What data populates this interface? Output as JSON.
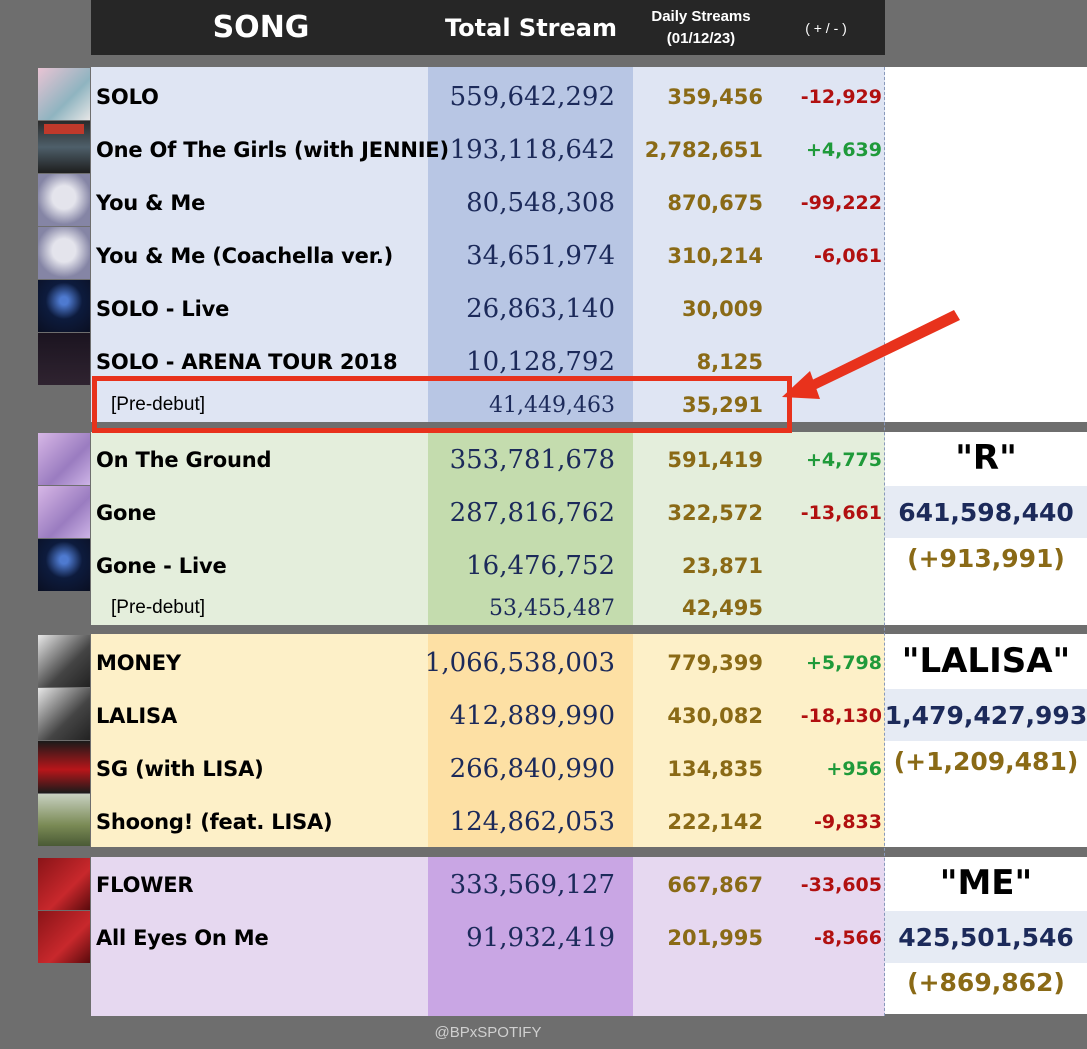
{
  "header": {
    "song": "SONG",
    "total_stream": "Total Stream",
    "daily_line1": "Daily Streams",
    "daily_line2": "(01/12/23)",
    "change": "( + / - )"
  },
  "groups": [
    {
      "rows": [
        {
          "song": "SOLO",
          "total": "559,642,292",
          "daily": "359,456",
          "change": "-12,929",
          "sign": "neg"
        },
        {
          "song": "One Of The Girls (with JENNIE)",
          "total": "193,118,642",
          "daily": "2,782,651",
          "change": "+4,639",
          "sign": "pos"
        },
        {
          "song": "You & Me",
          "total": "80,548,308",
          "daily": "870,675",
          "change": "-99,222",
          "sign": "neg"
        },
        {
          "song": "You & Me (Coachella ver.)",
          "total": "34,651,974",
          "daily": "310,214",
          "change": "-6,061",
          "sign": "neg"
        },
        {
          "song": "SOLO - Live",
          "total": "26,863,140",
          "daily": "30,009",
          "change": "",
          "sign": ""
        },
        {
          "song": "SOLO - ARENA TOUR 2018",
          "total": "10,128,792",
          "daily": "8,125",
          "change": "",
          "sign": ""
        }
      ],
      "predebut": {
        "label": "[Pre-debut]",
        "total": "41,449,463",
        "daily": "35,291"
      }
    },
    {
      "summary": {
        "title": "\"R\"",
        "total": "641,598,440",
        "change": "(+913,991)"
      },
      "rows": [
        {
          "song": "On The Ground",
          "total": "353,781,678",
          "daily": "591,419",
          "change": "+4,775",
          "sign": "pos"
        },
        {
          "song": "Gone",
          "total": "287,816,762",
          "daily": "322,572",
          "change": "-13,661",
          "sign": "neg"
        },
        {
          "song": "Gone - Live",
          "total": "16,476,752",
          "daily": "23,871",
          "change": "",
          "sign": ""
        }
      ],
      "predebut": {
        "label": "[Pre-debut]",
        "total": "53,455,487",
        "daily": "42,495"
      }
    },
    {
      "summary": {
        "title": "\"LALISA\"",
        "total": "1,479,427,993",
        "change": "(+1,209,481)"
      },
      "rows": [
        {
          "song": "MONEY",
          "total": "1,066,538,003",
          "daily": "779,399",
          "change": "+5,798",
          "sign": "pos"
        },
        {
          "song": "LALISA",
          "total": "412,889,990",
          "daily": "430,082",
          "change": "-18,130",
          "sign": "neg"
        },
        {
          "song": "SG (with LISA)",
          "total": "266,840,990",
          "daily": "134,835",
          "change": "+956",
          "sign": "pos"
        },
        {
          "song": "Shoong! (feat. LISA)",
          "total": "124,862,053",
          "daily": "222,142",
          "change": "-9,833",
          "sign": "neg"
        }
      ]
    },
    {
      "summary": {
        "title": "\"ME\"",
        "total": "425,501,546",
        "change": "(+869,862)"
      },
      "rows": [
        {
          "song": "FLOWER",
          "total": "333,569,127",
          "daily": "667,867",
          "change": "-33,605",
          "sign": "neg"
        },
        {
          "song": "All Eyes On Me",
          "total": "91,932,419",
          "daily": "201,995",
          "change": "-8,566",
          "sign": "neg"
        }
      ]
    }
  ],
  "footer": "@BPxSPOTIFY",
  "colors": {
    "header_bg": "#262626",
    "group1_bg": "#dfe5f3",
    "group1_total_bg": "#b8c6e4",
    "group2_bg": "#e4eedc",
    "group2_total_bg": "#c4dcae",
    "group3_bg": "#fdf0c8",
    "group3_total_bg": "#fde0a4",
    "group4_bg": "#e6d8f0",
    "group4_total_bg": "#c9a6e4",
    "highlight": "#e8321c",
    "negative": "#b11010",
    "positive": "#1f9a3a"
  }
}
